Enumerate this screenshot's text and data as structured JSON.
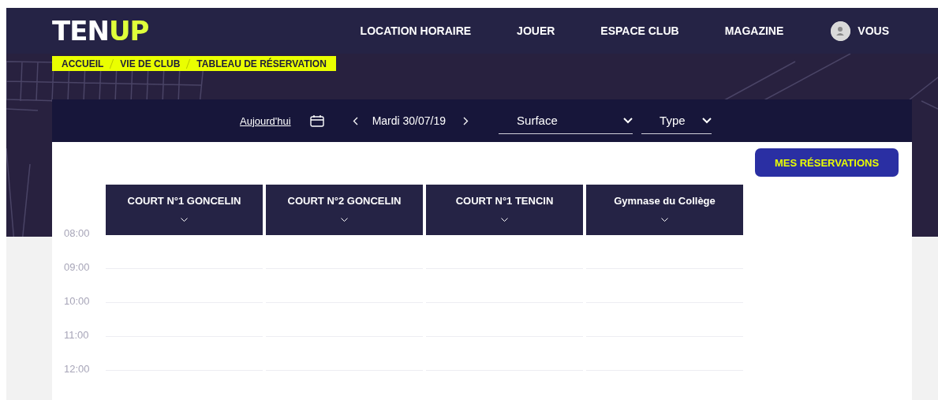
{
  "logo": {
    "primary": "TEN",
    "accent": "UP"
  },
  "nav": [
    {
      "label": "LOCATION HORAIRE"
    },
    {
      "label": "JOUER"
    },
    {
      "label": "ESPACE CLUB"
    },
    {
      "label": "MAGAZINE"
    }
  ],
  "user": {
    "label": "VOUS"
  },
  "breadcrumb": [
    "ACCUEIL",
    "VIE DE CLUB",
    "TABLEAU DE RÉSERVATION"
  ],
  "toolbar": {
    "today": "Aujourd'hui",
    "date": "Mardi 30/07/19",
    "filters": [
      {
        "label": "Surface"
      },
      {
        "label": "Type"
      }
    ]
  },
  "reservations_button": "MES RÉSERVATIONS",
  "courts": [
    "COURT N°1 GONCELIN",
    "COURT N°2 GONCELIN",
    "COURT N°1 TENCIN",
    "Gymnase du Collège"
  ],
  "times": [
    "08:00",
    "09:00",
    "10:00",
    "11:00",
    "12:00"
  ]
}
